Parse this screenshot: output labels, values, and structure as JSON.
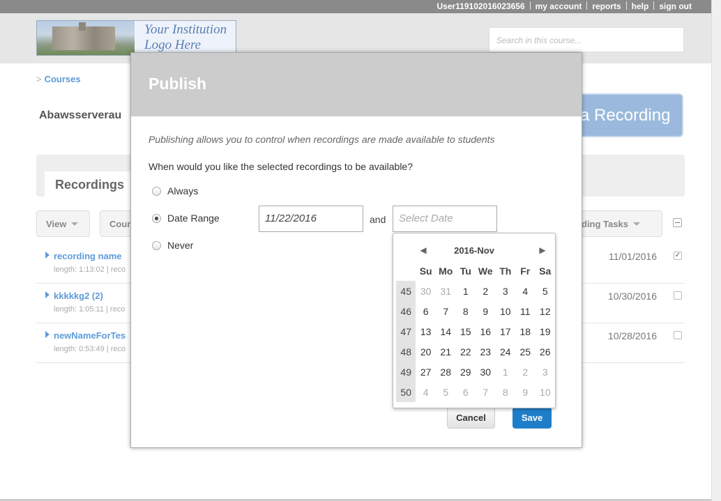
{
  "topbar": {
    "user": "User119102016023656",
    "my_account": "my account",
    "reports": "reports",
    "help": "help",
    "sign_out": "sign out"
  },
  "header": {
    "logo_line1": "Your Institution",
    "logo_line2": "Logo Here",
    "search_placeholder": "Search in this course..."
  },
  "page": {
    "breadcrumb": "Courses",
    "course_title": "Abawsserverau",
    "add_recording": "a Recording",
    "tab_recordings": "Recordings",
    "view_button": "View",
    "course_button": "Cour",
    "tasks_button": "ording Tasks",
    "rows": [
      {
        "name": "recording name",
        "meta": "length: 1:13:02 | reco",
        "date": "11/01/2016",
        "checked": true
      },
      {
        "name": "kkkkkg2 (2)",
        "meta": "length: 1:05:11 | reco",
        "date": "10/30/2016",
        "checked": false
      },
      {
        "name": "newNameForTes",
        "meta": "length: 0:53:49 | reco",
        "date": "10/28/2016",
        "checked": false
      }
    ]
  },
  "modal": {
    "title": "Publish",
    "intro": "Publishing allows you to control when recordings are made available to students",
    "question": "When would you like the selected recordings to be available?",
    "options": {
      "always": "Always",
      "date_range": "Date Range",
      "never": "Never"
    },
    "selected_option": "date_range",
    "start_date": "11/22/2016",
    "and_label": "and",
    "end_date_placeholder": "Select Date",
    "cancel": "Cancel",
    "save": "Save"
  },
  "calendar": {
    "title": "2016-Nov",
    "prev_icon": "prev-month-icon",
    "next_icon": "next-month-icon",
    "weekdays": [
      "Su",
      "Mo",
      "Tu",
      "We",
      "Th",
      "Fr",
      "Sa"
    ],
    "weeks": [
      {
        "wk": "45",
        "days": [
          "30",
          "31",
          "1",
          "2",
          "3",
          "4",
          "5"
        ],
        "out": [
          true,
          true,
          false,
          false,
          false,
          false,
          false
        ]
      },
      {
        "wk": "46",
        "days": [
          "6",
          "7",
          "8",
          "9",
          "10",
          "11",
          "12"
        ],
        "out": [
          false,
          false,
          false,
          false,
          false,
          false,
          false
        ]
      },
      {
        "wk": "47",
        "days": [
          "13",
          "14",
          "15",
          "16",
          "17",
          "18",
          "19"
        ],
        "out": [
          false,
          false,
          false,
          false,
          false,
          false,
          false
        ]
      },
      {
        "wk": "48",
        "days": [
          "20",
          "21",
          "22",
          "23",
          "24",
          "25",
          "26"
        ],
        "out": [
          false,
          false,
          false,
          false,
          false,
          false,
          false
        ]
      },
      {
        "wk": "49",
        "days": [
          "27",
          "28",
          "29",
          "30",
          "1",
          "2",
          "3"
        ],
        "out": [
          false,
          false,
          false,
          false,
          true,
          true,
          true
        ]
      },
      {
        "wk": "50",
        "days": [
          "4",
          "5",
          "6",
          "7",
          "8",
          "9",
          "10"
        ],
        "out": [
          true,
          true,
          true,
          true,
          true,
          true,
          true
        ]
      }
    ]
  }
}
